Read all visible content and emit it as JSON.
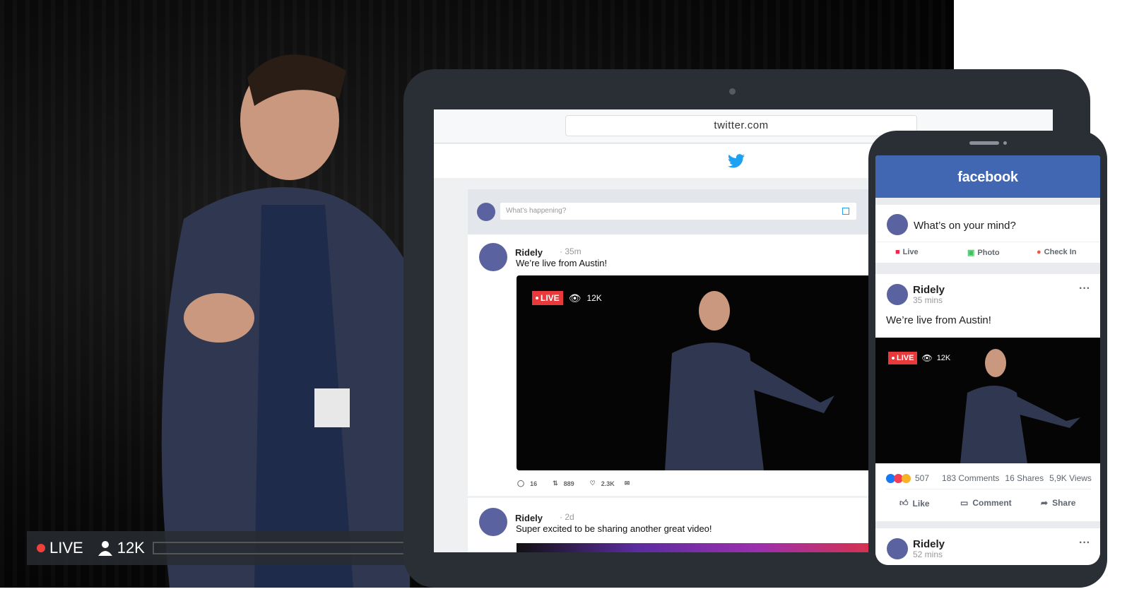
{
  "stream_overlay": {
    "live_label": "LIVE",
    "viewers": "12K",
    "progress": 0.66
  },
  "tablet": {
    "url": "twitter.com",
    "compose_placeholder": "What's happening?",
    "tweets": [
      {
        "name": "Ridely",
        "time": "· 35m",
        "text": "We’re live from Austin!",
        "live_label": "LIVE",
        "views": "12K",
        "replies": "16",
        "retweets": "889",
        "likes": "2.3K"
      },
      {
        "name": "Ridely",
        "time": "· 2d",
        "text": "Super excited to be sharing another great video!"
      }
    ]
  },
  "phone": {
    "brand": "facebook",
    "compose_placeholder": "What’s on your mind?",
    "compose_actions": [
      "Live",
      "Photo",
      "Check In"
    ],
    "posts": [
      {
        "name": "Ridely",
        "time": "35 mins",
        "text": "We’re live from Austin!",
        "live_label": "LIVE",
        "views": "12K",
        "reactions": "507",
        "comments": "183 Comments",
        "shares": "16 Shares",
        "video_views": "5,9K Views",
        "actions": [
          "Like",
          "Comment",
          "Share"
        ],
        "more": "···"
      },
      {
        "name": "Ridely",
        "time": "52 mins",
        "more": "···"
      }
    ]
  },
  "colors": {
    "facebook_blue": "#4267b2",
    "twitter_blue": "#1da1f2",
    "live_red": "#e8393b",
    "avatar": "#5a62a0"
  }
}
